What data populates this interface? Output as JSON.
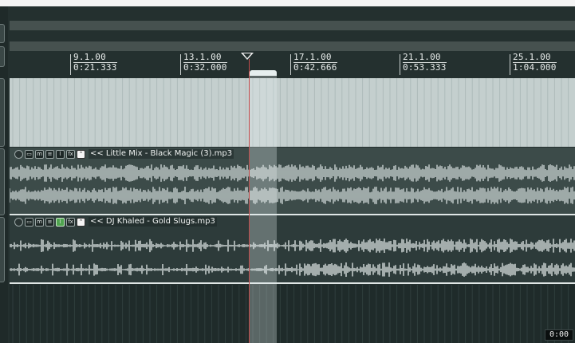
{
  "ruler": {
    "markers": [
      {
        "measure": "9.1.00",
        "time": "0:21.333"
      },
      {
        "measure": "13.1.00",
        "time": "0:32.000"
      },
      {
        "measure": "17.1.00",
        "time": "0:42.666"
      },
      {
        "measure": "21.1.00",
        "time": "0:53.333"
      },
      {
        "measure": "25.1.00",
        "time": "1:04.000"
      }
    ]
  },
  "tracks": [
    {
      "name": "<< Little Mix - Black Magic (3).mp3",
      "fx_active": false,
      "wave_color": "#c9d2d1"
    },
    {
      "name": "<< DJ Khaled - Gold Slugs.mp3",
      "fx_active": true,
      "wave_color": "#d7dfde"
    }
  ],
  "track_button_icons": [
    "power-icon",
    "folder-icon",
    "mute-icon",
    "solo-icon",
    "fx-icon",
    "record-arm-icon",
    "envelope-icon"
  ],
  "status": {
    "time": "0:00"
  },
  "colors": {
    "cursor": "#c24a4a",
    "fx_active": "#4fa34f",
    "background": "#24302f"
  }
}
